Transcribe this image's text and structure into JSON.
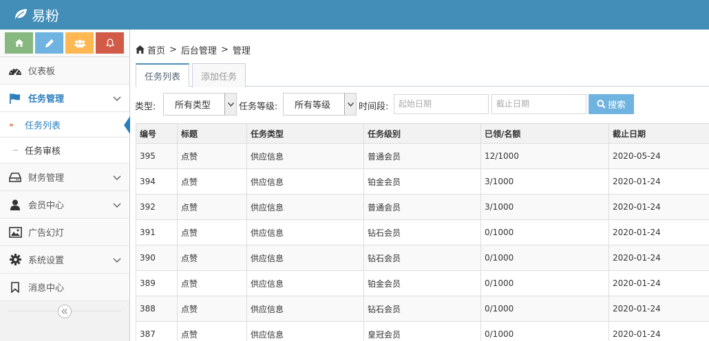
{
  "app": {
    "brand": "易粉"
  },
  "sidebar": {
    "shortcuts": [
      {
        "icon": "home-icon",
        "color": "#87b87f"
      },
      {
        "icon": "pencil-icon",
        "color": "#6fb3e0"
      },
      {
        "icon": "users-icon",
        "color": "#ffb752"
      },
      {
        "icon": "bell-icon",
        "color": "#d15b47"
      }
    ],
    "items": [
      {
        "label": "仪表板",
        "icon": "dashboard-icon"
      },
      {
        "label": "任务管理",
        "icon": "flag-icon",
        "active": true,
        "children": [
          {
            "label": "任务列表",
            "selected": true
          },
          {
            "label": "任务审核"
          }
        ]
      },
      {
        "label": "财务管理",
        "icon": "inbox-icon"
      },
      {
        "label": "会员中心",
        "icon": "user-icon"
      },
      {
        "label": "广告幻灯",
        "icon": "picture-icon"
      },
      {
        "label": "系统设置",
        "icon": "gear-icon"
      },
      {
        "label": "消息中心",
        "icon": "bookmark-icon"
      }
    ]
  },
  "breadcrumb": {
    "home": "首页",
    "level2": "后台管理",
    "level3": "管理",
    "separator": ">"
  },
  "tabs": [
    {
      "label": "任务列表",
      "active": true
    },
    {
      "label": "添加任务"
    }
  ],
  "filters": {
    "type_label": "类型:",
    "type_value": "所有类型",
    "level_label": "任务等级:",
    "level_value": "所有等级",
    "period_label": "时间段:",
    "start_placeholder": "起始日期",
    "end_placeholder": "截止日期",
    "search_label": "搜索"
  },
  "table": {
    "headers": [
      "编号",
      "标题",
      "任务类型",
      "任务级别",
      "已领/名额",
      "截止日期"
    ],
    "rows": [
      [
        "395",
        "点赞",
        "供应信息",
        "普通会员",
        "12/1000",
        "2020-05-24"
      ],
      [
        "394",
        "点赞",
        "供应信息",
        "铂金会员",
        "3/1000",
        "2020-01-24"
      ],
      [
        "392",
        "点赞",
        "供应信息",
        "普通会员",
        "3/1000",
        "2020-01-24"
      ],
      [
        "391",
        "点赞",
        "供应信息",
        "钻石会员",
        "0/1000",
        "2020-01-24"
      ],
      [
        "390",
        "点赞",
        "供应信息",
        "钻石会员",
        "0/1000",
        "2020-01-24"
      ],
      [
        "389",
        "点赞",
        "供应信息",
        "铂金会员",
        "0/1000",
        "2020-01-24"
      ],
      [
        "388",
        "点赞",
        "供应信息",
        "钻石会员",
        "0/1000",
        "2020-01-24"
      ],
      [
        "387",
        "点赞",
        "供应信息",
        "皇冠会员",
        "0/1000",
        "2020-01-24"
      ]
    ]
  },
  "colors": {
    "navbar": "#438eb9",
    "accent": "#2b7dbc",
    "search_button": "#6fb3e0"
  }
}
